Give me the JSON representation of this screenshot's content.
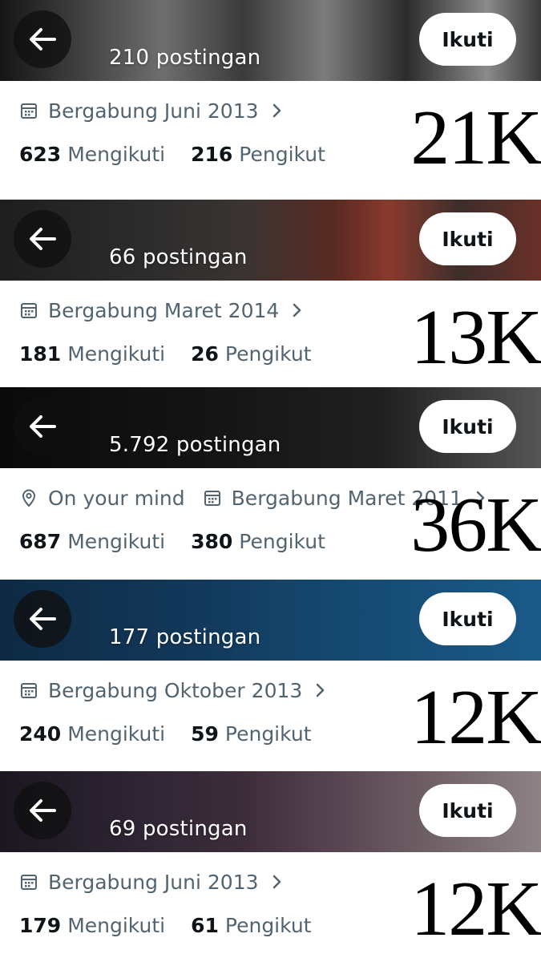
{
  "profiles": [
    {
      "posts": "210 postingan",
      "location": "",
      "joined": "Bergabung Juni 2013",
      "following_count": "623",
      "following_label": "Mengikuti",
      "followers_count": "216",
      "followers_label": "Pengikut",
      "follow_label": "Ikuti",
      "views": "21K"
    },
    {
      "posts": "66 postingan",
      "location": "",
      "joined": "Bergabung Maret 2014",
      "following_count": "181",
      "following_label": "Mengikuti",
      "followers_count": "26",
      "followers_label": "Pengikut",
      "follow_label": "Ikuti",
      "views": "13K"
    },
    {
      "posts": "5.792 postingan",
      "location": "On your mind",
      "joined": "Bergabung Maret 2011",
      "following_count": "687",
      "following_label": "Mengikuti",
      "followers_count": "380",
      "followers_label": "Pengikut",
      "follow_label": "Ikuti",
      "views": "36K"
    },
    {
      "posts": "177 postingan",
      "location": "",
      "joined": "Bergabung Oktober 2013",
      "following_count": "240",
      "following_label": "Mengikuti",
      "followers_count": "59",
      "followers_label": "Pengikut",
      "follow_label": "Ikuti",
      "views": "12K"
    },
    {
      "posts": "69 postingan",
      "location": "",
      "joined": "Bergabung Juni 2013",
      "following_count": "179",
      "following_label": "Mengikuti",
      "followers_count": "61",
      "followers_label": "Pengikut",
      "follow_label": "Ikuti",
      "views": "12K"
    }
  ],
  "icons": {
    "back": "arrow-left-icon",
    "calendar": "calendar-icon",
    "location": "location-pin-icon",
    "chevron": "chevron-right-icon"
  },
  "colors": {
    "text_primary": "#0f1419",
    "text_secondary": "#536471",
    "button_bg": "#ffffff"
  }
}
